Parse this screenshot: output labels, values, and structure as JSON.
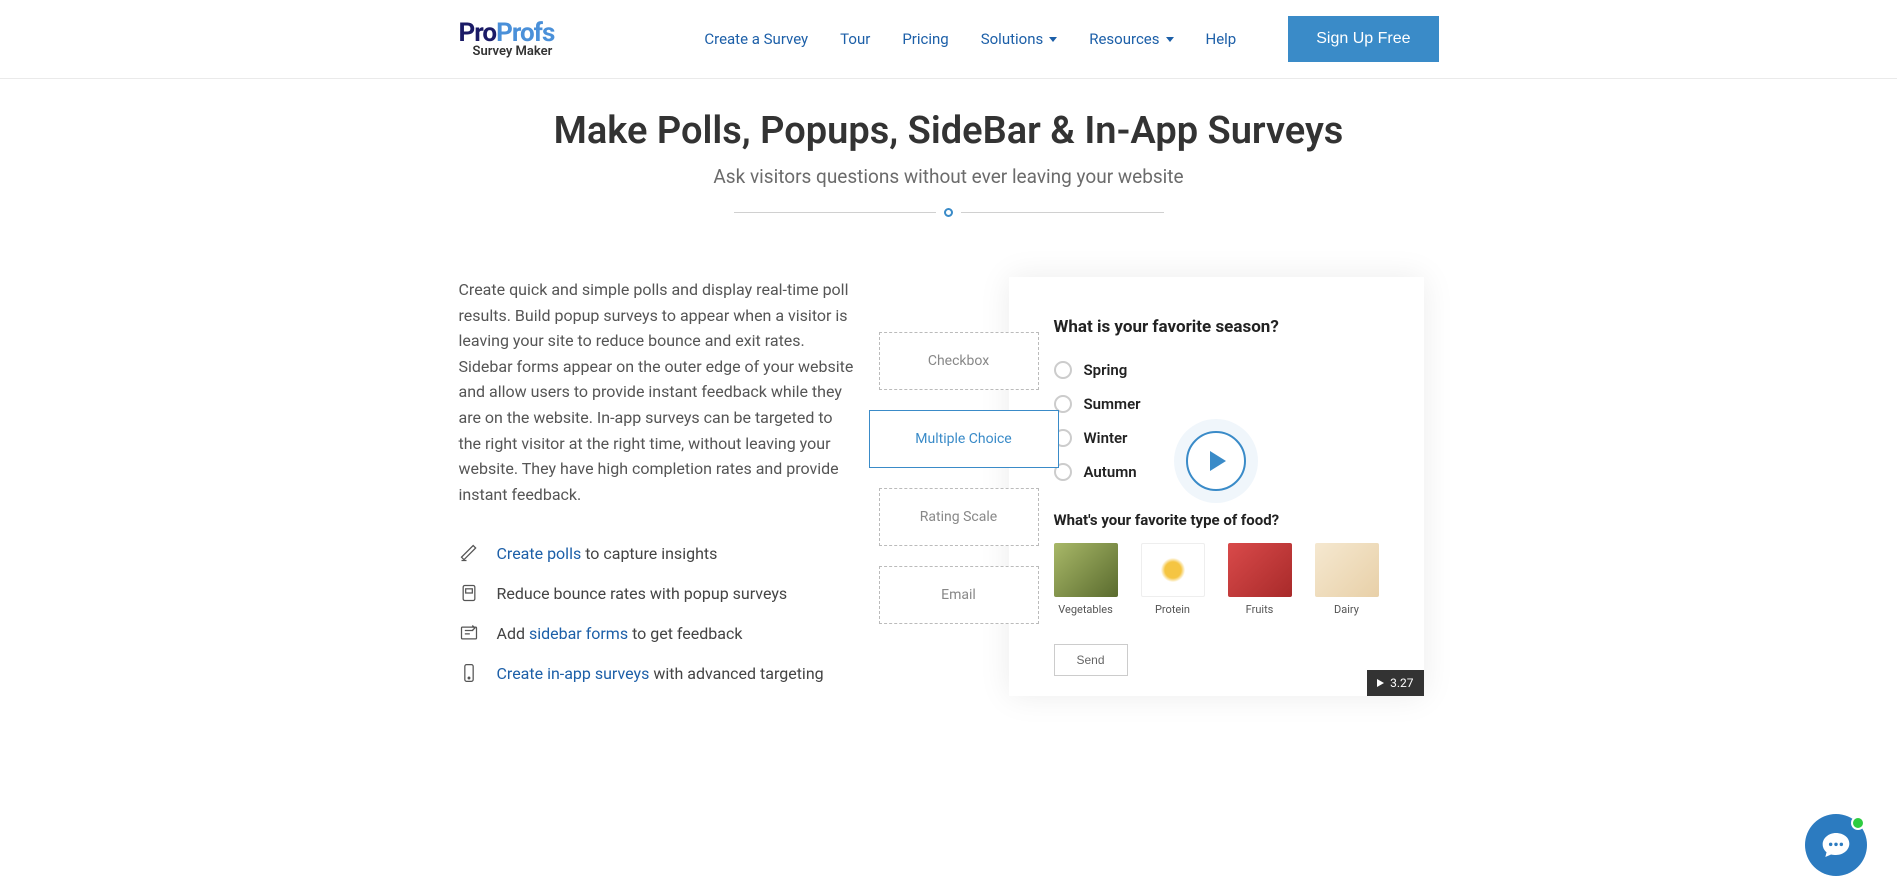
{
  "logo": {
    "part1": "Pro",
    "part2": "Profs",
    "sub": "Survey Maker"
  },
  "nav": {
    "create": "Create a Survey",
    "tour": "Tour",
    "pricing": "Pricing",
    "solutions": "Solutions",
    "resources": "Resources",
    "help": "Help",
    "signup": "Sign Up Free"
  },
  "hero": {
    "title": "Make Polls, Popups, SideBar & In-App Surveys",
    "subtitle": "Ask visitors questions without ever leaving your website"
  },
  "description": "Create quick and simple polls and display real-time poll results. Build popup surveys to appear when a visitor is leaving your site to reduce bounce and exit rates. Sidebar forms appear on the outer edge of your website and allow users to provide instant feedback while they are on the website. In-app surveys can be targeted to the right visitor at the right time, without leaving your website. They have high completion rates and provide instant feedback.",
  "features": [
    {
      "prefix": "",
      "link": "Create polls",
      "suffix": " to capture insights"
    },
    {
      "prefix": "Reduce bounce rates with popup surveys",
      "link": "",
      "suffix": ""
    },
    {
      "prefix": "Add ",
      "link": "sidebar forms",
      "suffix": " to get feedback"
    },
    {
      "prefix": "",
      "link": "Create in-app surveys",
      "suffix": " with advanced targeting"
    }
  ],
  "qtypes": [
    "Checkbox",
    "Multiple Choice",
    "Rating Scale",
    "Email"
  ],
  "preview": {
    "q1": "What is your favorite season?",
    "options": [
      "Spring",
      "Summer",
      "Winter",
      "Autumn"
    ],
    "q2": "What's your favorite type of food?",
    "foods": [
      "Vegetables",
      "Protein",
      "Fruits",
      "Dairy"
    ],
    "send": "Send",
    "duration": "3.27"
  }
}
